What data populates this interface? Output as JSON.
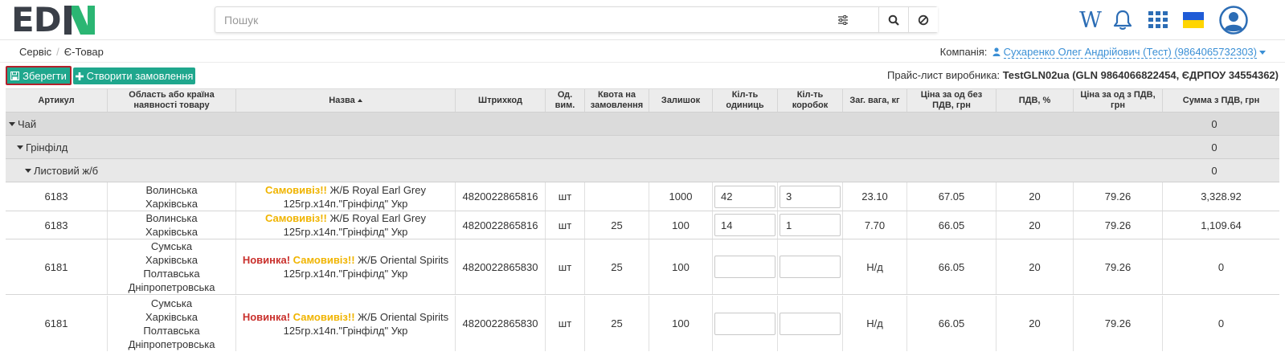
{
  "colors": {
    "accent": "#1fa78d",
    "logo_green": "#2bb673",
    "link": "#3a8fd5",
    "highlight": "#b3202b",
    "new_tag": "#c9302c",
    "self_tag": "#f0b400"
  },
  "header": {
    "logo_text": "ED",
    "logo_mark": "NI",
    "search_placeholder": "Пошук",
    "search_value": "",
    "icons": [
      "filter-icon",
      "search-icon",
      "clear-icon",
      "wiki-icon",
      "bell-icon",
      "apps-grid-icon",
      "ua-flag-icon",
      "user-avatar-icon"
    ]
  },
  "breadcrumb": {
    "items": [
      "Сервіс",
      "Є-Товар"
    ]
  },
  "company": {
    "label": "Компанія:",
    "name": "Сухаренко Олег Андрійович (Тест) (9864065732303)"
  },
  "toolbar": {
    "save_label": "Зберегти",
    "order_label": "Створити замовлення",
    "pricelist_label": "Прайс-лист виробника:",
    "pricelist_value": "TestGLN02ua (GLN 9864066822454, ЄДРПОУ 34554362)"
  },
  "table": {
    "columns": [
      "Артикул",
      "Область або країна наявності товару",
      "Назва",
      "Штрихкод",
      "Од. вим.",
      "Квота на замовлення",
      "Залишок",
      "Кіл-ть одиниць",
      "Кіл-ть коробок",
      "Заг. вага, кг",
      "Ціна за од без ПДВ, грн",
      "ПДВ, %",
      "Ціна за од з ПДВ, грн",
      "Сумма з ПДВ, грн"
    ],
    "groups": [
      {
        "label": "Чай",
        "total": "0"
      },
      {
        "label": "Грінфілд",
        "total": "0"
      },
      {
        "label": "Листовий ж/б",
        "total": "0"
      }
    ],
    "rows": [
      {
        "article": "6183",
        "regions": [
          "Волинська",
          "Харківська"
        ],
        "tag_new": "",
        "tag_self": "Самовивіз!!",
        "name1": " Ж/Б Royal Earl Grey",
        "name2": "125гр.х14п.\"Грінфілд\" Укр",
        "barcode": "4820022865816",
        "unit": "шт",
        "quota": "",
        "stock": "1000",
        "qty_units": "42",
        "qty_boxes": "3",
        "weight": "23.10",
        "price_no_vat": "67.05",
        "vat": "20",
        "price_vat": "79.26",
        "sum": "3,328.92"
      },
      {
        "article": "6183",
        "regions": [
          "Волинська",
          "Харківська"
        ],
        "tag_new": "",
        "tag_self": "Самовивіз!!",
        "name1": " Ж/Б Royal Earl Grey",
        "name2": "125гр.х14п.\"Грінфілд\" Укр",
        "barcode": "4820022865816",
        "unit": "шт",
        "quota": "25",
        "stock": "100",
        "qty_units": "14",
        "qty_boxes": "1",
        "weight": "7.70",
        "price_no_vat": "66.05",
        "vat": "20",
        "price_vat": "79.26",
        "sum": "1,109.64"
      },
      {
        "article": "6181",
        "regions": [
          "Сумська",
          "Харківська",
          "Полтавська",
          "Дніпропетровська"
        ],
        "tag_new": "Новинка!",
        "tag_self": "Самовивіз!!",
        "name1": " Ж/Б Oriental Spirits",
        "name2": "125гр.х14п.\"Грінфілд\" Укр",
        "barcode": "4820022865830",
        "unit": "шт",
        "quota": "25",
        "stock": "100",
        "qty_units": "",
        "qty_boxes": "",
        "weight": "Н/д",
        "price_no_vat": "66.05",
        "vat": "20",
        "price_vat": "79.26",
        "sum": "0"
      },
      {
        "article": "6181",
        "regions": [
          "Сумська",
          "Харківська",
          "Полтавська",
          "Дніпропетровська"
        ],
        "tag_new": "Новинка!",
        "tag_self": "Самовивіз!!",
        "name1": " Ж/Б Oriental Spirits",
        "name2": "125гр.х14п.\"Грінфілд\" Укр",
        "barcode": "4820022865830",
        "unit": "шт",
        "quota": "25",
        "stock": "100",
        "qty_units": "",
        "qty_boxes": "",
        "weight": "Н/д",
        "price_no_vat": "66.05",
        "vat": "20",
        "price_vat": "79.26",
        "sum": "0"
      }
    ]
  }
}
